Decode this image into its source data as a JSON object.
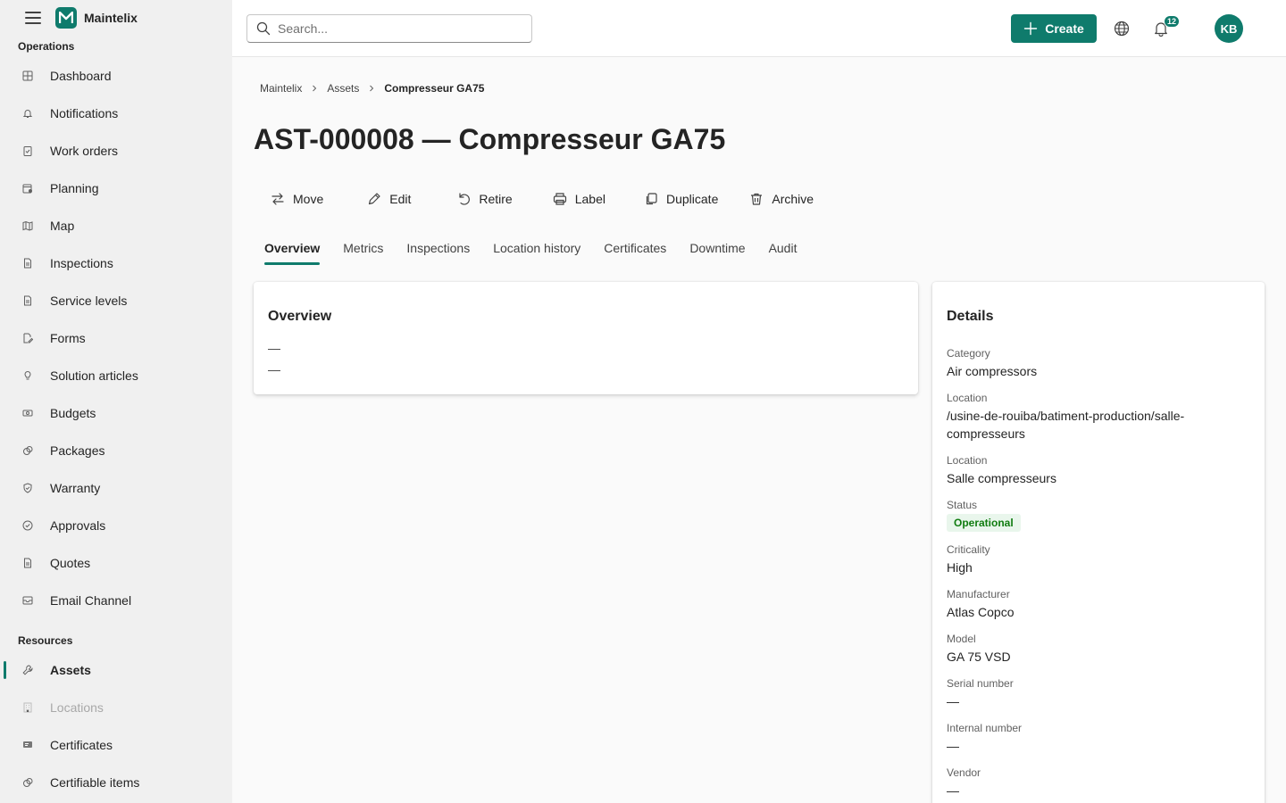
{
  "app": {
    "name": "Maintelix"
  },
  "sidebar": {
    "sections": [
      {
        "title": "Operations",
        "items": [
          {
            "label": "Dashboard",
            "icon": "dashboard-icon"
          },
          {
            "label": "Notifications",
            "icon": "bell-icon"
          },
          {
            "label": "Work orders",
            "icon": "clipboard-icon"
          },
          {
            "label": "Planning",
            "icon": "calendar-icon"
          },
          {
            "label": "Map",
            "icon": "map-icon"
          },
          {
            "label": "Inspections",
            "icon": "document-icon"
          },
          {
            "label": "Service levels",
            "icon": "document-icon"
          },
          {
            "label": "Forms",
            "icon": "form-edit-icon"
          },
          {
            "label": "Solution articles",
            "icon": "lightbulb-icon"
          },
          {
            "label": "Budgets",
            "icon": "money-icon"
          },
          {
            "label": "Packages",
            "icon": "package-icon"
          },
          {
            "label": "Warranty",
            "icon": "shield-icon"
          },
          {
            "label": "Approvals",
            "icon": "check-circle-icon"
          },
          {
            "label": "Quotes",
            "icon": "document-icon"
          },
          {
            "label": "Email Channel",
            "icon": "mail-icon"
          }
        ]
      },
      {
        "title": "Resources",
        "items": [
          {
            "label": "Assets",
            "icon": "wrench-icon",
            "active": true
          },
          {
            "label": "Locations",
            "icon": "building-icon",
            "disabled": true
          },
          {
            "label": "Certificates",
            "icon": "certificate-icon"
          },
          {
            "label": "Certifiable items",
            "icon": "package-icon"
          }
        ]
      }
    ]
  },
  "topbar": {
    "search_placeholder": "Search...",
    "create_label": "Create",
    "notification_count": "12",
    "avatar_initials": "KB"
  },
  "breadcrumb": [
    "Maintelix",
    "Assets",
    "Compresseur GA75"
  ],
  "page": {
    "title": "AST-000008 — Compresseur GA75",
    "actions": [
      {
        "label": "Move",
        "icon": "arrows-swap-icon"
      },
      {
        "label": "Edit",
        "icon": "pencil-icon"
      },
      {
        "label": "Retire",
        "icon": "undo-icon"
      },
      {
        "label": "Label",
        "icon": "printer-icon"
      },
      {
        "label": "Duplicate",
        "icon": "copy-icon"
      },
      {
        "label": "Archive",
        "icon": "trash-icon"
      }
    ],
    "tabs": [
      "Overview",
      "Metrics",
      "Inspections",
      "Location history",
      "Certificates",
      "Downtime",
      "Audit"
    ],
    "active_tab": "Overview"
  },
  "overview": {
    "title": "Overview",
    "lines": [
      "—",
      "—"
    ]
  },
  "details": {
    "title": "Details",
    "fields": [
      {
        "label": "Category",
        "value": "Air compressors"
      },
      {
        "label": "Location",
        "value": "/usine-de-rouiba/batiment-production/salle-compresseurs"
      },
      {
        "label": "Location",
        "value": "Salle compresseurs"
      },
      {
        "label": "Status",
        "value": "Operational",
        "pill": true
      },
      {
        "label": "Criticality",
        "value": "High"
      },
      {
        "label": "Manufacturer",
        "value": "Atlas Copco"
      },
      {
        "label": "Model",
        "value": "GA 75 VSD"
      },
      {
        "label": "Serial number",
        "value": "—"
      },
      {
        "label": "Internal number",
        "value": "—"
      },
      {
        "label": "Vendor",
        "value": "—"
      }
    ]
  },
  "colors": {
    "accent": "#0f7b6c",
    "status_ok": "#107c10"
  }
}
